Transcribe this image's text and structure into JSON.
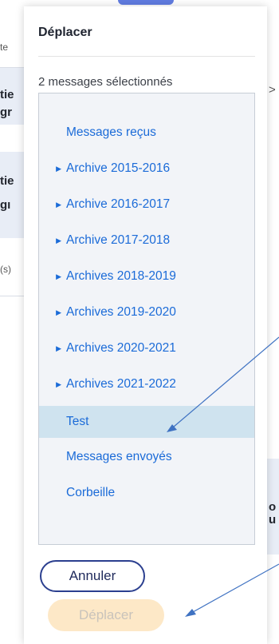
{
  "background": {
    "left_fragments": [
      "te",
      "tie",
      "gr",
      "tie",
      "gı",
      "(s)"
    ],
    "right_fragments": [
      ">",
      "o",
      "u"
    ]
  },
  "dialog": {
    "title": "Déplacer",
    "selection_count": "2 messages sélectionnés",
    "folders": [
      {
        "label": "Messages reçus",
        "expandable": false,
        "selected": false
      },
      {
        "label": "Archive 2015-2016",
        "expandable": true,
        "selected": false
      },
      {
        "label": "Archive 2016-2017",
        "expandable": true,
        "selected": false
      },
      {
        "label": "Archive 2017-2018",
        "expandable": true,
        "selected": false
      },
      {
        "label": "Archives 2018-2019",
        "expandable": true,
        "selected": false
      },
      {
        "label": "Archives 2019-2020",
        "expandable": true,
        "selected": false
      },
      {
        "label": "Archives 2020-2021",
        "expandable": true,
        "selected": false
      },
      {
        "label": "Archives 2021-2022",
        "expandable": true,
        "selected": false
      },
      {
        "label": "Test",
        "expandable": false,
        "selected": true
      },
      {
        "label": "Messages envoyés",
        "expandable": false,
        "selected": false
      },
      {
        "label": "Corbeille",
        "expandable": false,
        "selected": false
      }
    ],
    "cancel_label": "Annuler",
    "move_label": "Déplacer",
    "move_disabled": true
  },
  "colors": {
    "link": "#1b6bd8",
    "selected_row": "#cfe3ef",
    "cancel_border": "#2b3f8f",
    "move_bg_disabled": "#fde8c7",
    "annotation_arrow": "#3f72c2"
  }
}
